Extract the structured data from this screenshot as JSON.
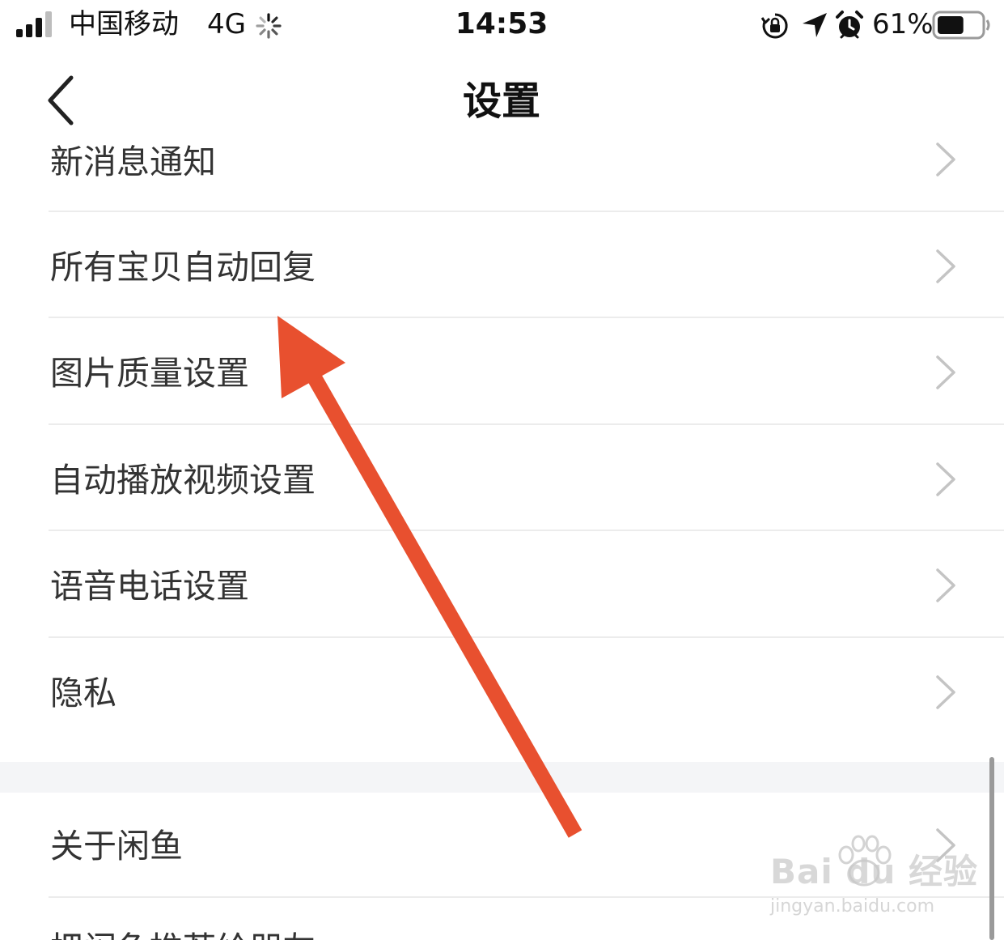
{
  "status_bar": {
    "carrier": "中国移动",
    "network": "4G",
    "time": "14:53",
    "battery_percent": "61%",
    "battery_level": 0.61,
    "icons": [
      "signal-icon",
      "loading-icon",
      "orientation-lock-icon",
      "location-icon",
      "alarm-icon",
      "battery-icon"
    ]
  },
  "nav_bar": {
    "title": "设置",
    "back_icon": "chevron-left-icon"
  },
  "settings": {
    "items": [
      {
        "label": "新消息通知"
      },
      {
        "label": "所有宝贝自动回复"
      },
      {
        "label": "图片质量设置"
      },
      {
        "label": "自动播放视频设置"
      },
      {
        "label": "语音电话设置"
      },
      {
        "label": "隐私"
      }
    ],
    "section2": [
      {
        "label": "关于闲鱼"
      }
    ],
    "partial_item": {
      "label": "把闲鱼推荐给朋友"
    }
  },
  "annotation": {
    "type": "arrow",
    "color": "#e8502f"
  },
  "watermark": {
    "logo": "Bai du 经验",
    "url": "jingyan.baidu.com"
  },
  "colors": {
    "text_primary": "#333333",
    "divider": "#ececec",
    "section_gap": "#f4f5f7",
    "chevron": "#c4c4c4",
    "arrow": "#e8502f"
  }
}
